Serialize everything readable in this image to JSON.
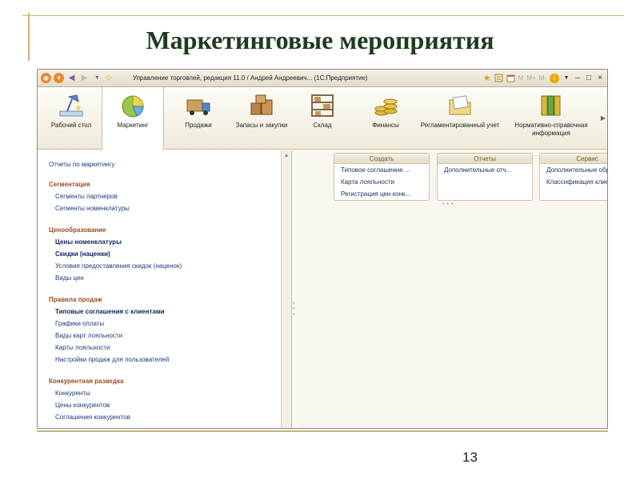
{
  "slide": {
    "title": "Маркетинговые мероприятия",
    "page_number": "13"
  },
  "window": {
    "title": "Управление торговлей, редакция 11.0 / Андрей Андреевич... (1С:Предприятие)",
    "toolbar_m_labels": [
      "M",
      "M+",
      "M-"
    ]
  },
  "sections": [
    {
      "label": "Рабочий стол",
      "icon": "desk-lamp-icon"
    },
    {
      "label": "Маркетинг",
      "icon": "pie-chart-icon",
      "active": true
    },
    {
      "label": "Продажи",
      "icon": "truck-icon"
    },
    {
      "label": "Запасы и закупки",
      "icon": "boxes-icon"
    },
    {
      "label": "Склад",
      "icon": "shelf-icon"
    },
    {
      "label": "Финансы",
      "icon": "coins-icon"
    },
    {
      "label": "Регламентированный учет",
      "icon": "folder-icon"
    },
    {
      "label": "Нормативно-справочная информация",
      "icon": "binders-icon"
    }
  ],
  "nav": {
    "top_link": "Отчеты по маркетингу",
    "groups": [
      {
        "title": "Сегментация",
        "items": [
          {
            "label": "Сегменты партнеров",
            "bold": false
          },
          {
            "label": "Сегменты номенклатуры",
            "bold": false
          }
        ]
      },
      {
        "title": "Ценообразование",
        "items": [
          {
            "label": "Цены номенклатуры",
            "bold": true
          },
          {
            "label": "Скидки (наценки)",
            "bold": true
          },
          {
            "label": "Условия предоставления скидок (наценок)",
            "bold": false
          },
          {
            "label": "Виды цен",
            "bold": false
          }
        ]
      },
      {
        "title": "Правила продаж",
        "items": [
          {
            "label": "Типовые соглашения с клиентами",
            "bold": true
          },
          {
            "label": "Графики оплаты",
            "bold": false
          },
          {
            "label": "Виды карт лояльности",
            "bold": false
          },
          {
            "label": "Карты лояльности",
            "bold": false
          },
          {
            "label": "Настройки продаж для пользователей",
            "bold": false
          }
        ]
      },
      {
        "title": "Конкурентная разведка",
        "items": [
          {
            "label": "Конкуренты",
            "bold": false
          },
          {
            "label": "Цены конкурентов",
            "bold": false
          },
          {
            "label": "Соглашения конкурентов",
            "bold": false
          }
        ]
      }
    ]
  },
  "panels": {
    "create": {
      "title": "Создать",
      "items": [
        "Типовое соглашение ...",
        "Карта лояльности",
        "Регистрация цен конк..."
      ]
    },
    "reports": {
      "title": "Отчеты",
      "items": [
        "Дополнительные отч..."
      ]
    },
    "service": {
      "title": "Сервис",
      "items": [
        "Дополнительные обр...",
        "Классификация клие..."
      ]
    }
  }
}
